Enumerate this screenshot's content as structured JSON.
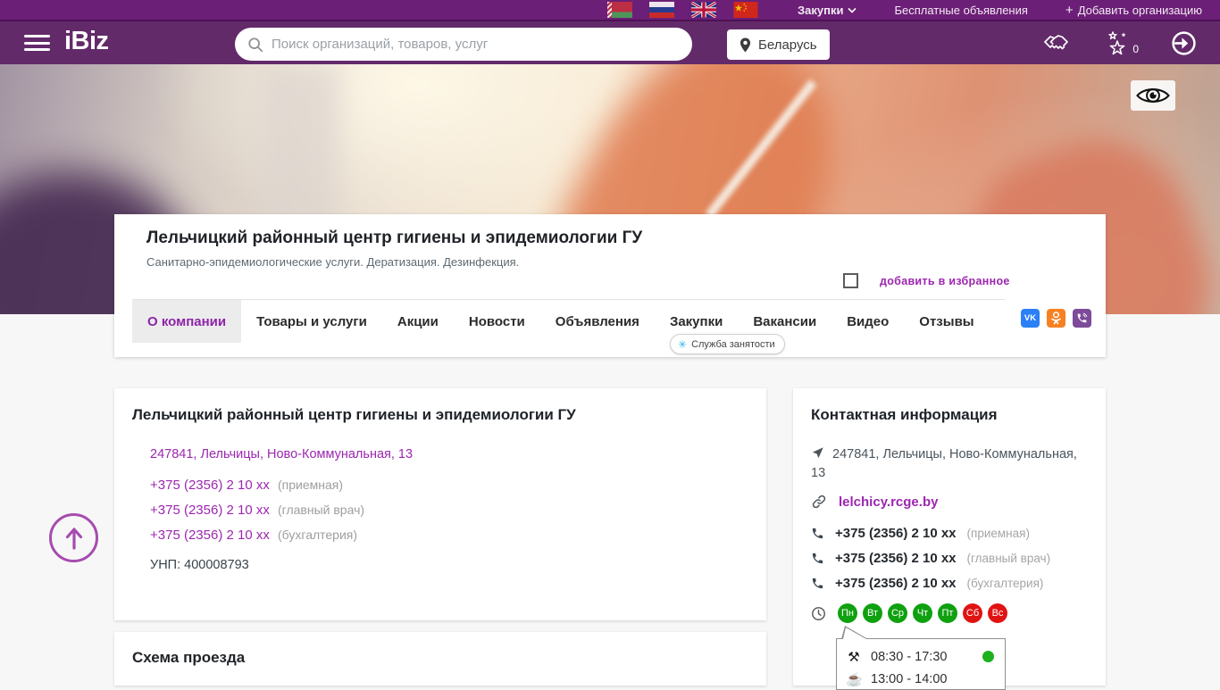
{
  "topbar": {
    "procurement_label": "Закупки",
    "free_ads_label": "Бесплатные объявления",
    "add_org_label": "Добавить организацию"
  },
  "header": {
    "logo": "iBiz",
    "search_placeholder": "Поиск организаций, товаров, услуг",
    "location": "Беларусь",
    "favorites_count": "0"
  },
  "company": {
    "title": "Лельчицкий районный центр гигиены и эпидемиологии ГУ",
    "subtitle": "Санитарно-эпидемиологические услуги. Дератизация. Дезинфекция.",
    "favorite_label": "добавить в избранное",
    "employment_badge": "Служба занятости",
    "tabs": [
      {
        "label": "О компании",
        "active": true
      },
      {
        "label": "Товары и услуги",
        "active": false
      },
      {
        "label": "Акции",
        "active": false
      },
      {
        "label": "Новости",
        "active": false
      },
      {
        "label": "Объявления",
        "active": false
      },
      {
        "label": "Закупки",
        "active": false
      },
      {
        "label": "Вакансии",
        "active": false
      },
      {
        "label": "Видео",
        "active": false
      },
      {
        "label": "Отзывы",
        "active": false
      }
    ]
  },
  "about_card": {
    "title": "Лельчицкий районный центр гигиены и эпидемиологии ГУ",
    "address": "247841, Лельчицы, Ново-Коммунальная, 13",
    "phones": [
      {
        "number": "+375 (2356) 2 10 xx",
        "label": "(приемная)"
      },
      {
        "number": "+375 (2356) 2 10 xx",
        "label": "(главный врач)"
      },
      {
        "number": "+375 (2356) 2 10 xx",
        "label": "(бухгалтерия)"
      }
    ],
    "unp_label": "УНП:",
    "unp_value": "400008793"
  },
  "map_card": {
    "title": "Схема проезда"
  },
  "contact_card": {
    "title": "Контактная информация",
    "address": "247841, Лельчицы, Ново-Коммунальная, 13",
    "website": "lelchicy.rcge.by",
    "phones": [
      {
        "number": "+375 (2356) 2 10 xx",
        "label": "(приемная)"
      },
      {
        "number": "+375 (2356) 2 10 xx",
        "label": "(главный врач)"
      },
      {
        "number": "+375 (2356) 2 10 xx",
        "label": "(бухгалтерия)"
      }
    ],
    "schedule": {
      "days": [
        {
          "label": "Пн",
          "status": "work"
        },
        {
          "label": "Вт",
          "status": "work"
        },
        {
          "label": "Ср",
          "status": "work"
        },
        {
          "label": "Чт",
          "status": "work"
        },
        {
          "label": "Пт",
          "status": "work"
        },
        {
          "label": "Сб",
          "status": "off"
        },
        {
          "label": "Вс",
          "status": "off"
        }
      ],
      "work_hours": "08:30 - 17:30",
      "break_hours": "13:00 - 14:00"
    }
  },
  "icons": {
    "plus": "+",
    "work_tools": "⚒",
    "coffee_cup": "☕",
    "employment_asterisk": "✳",
    "vk_glyph": "VK"
  },
  "colors": {
    "topbar": "#6c1f76",
    "header": "#632a6a",
    "accent": "#9c27b0",
    "active_tab_text": "#8e24aa",
    "work_day": "#0fa10f",
    "off_day": "#e01313",
    "vk": "#2b80f6",
    "ok": "#f78122",
    "viber": "#7d4b99"
  }
}
